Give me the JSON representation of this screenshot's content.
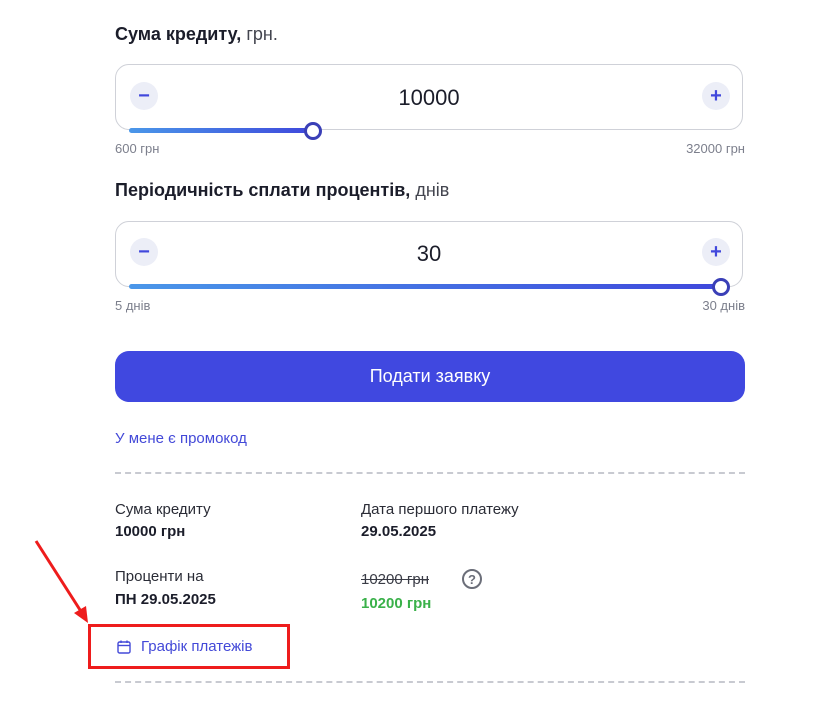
{
  "loan_amount": {
    "title": "Сума кредиту,",
    "unit": "грн.",
    "value": "10000",
    "min_label": "600 грн",
    "max_label": "32000 грн",
    "level_fraction": 0.31,
    "decrease_icon": "minus-icon",
    "increase_icon": "plus-icon"
  },
  "interest_period": {
    "title": "Періодичність сплати процентів,",
    "unit": "днів",
    "value": "30",
    "min_label": "5 днів",
    "max_label": "30 днів",
    "level_fraction": 1.0,
    "decrease_icon": "minus-icon",
    "increase_icon": "plus-icon"
  },
  "submit_label": "Подати заявку",
  "promo_link": "У мене є промокод",
  "summary": {
    "amount_label": "Сума кредиту",
    "amount_value": "10000 грн",
    "first_payment_label": "Дата першого платежу",
    "first_payment_value": "29.05.2025",
    "interest_label": "Проценти на",
    "interest_date": "ПН 29.05.2025",
    "old_total": "10200 грн",
    "new_total": "10200 грн",
    "help_icon": "question-icon"
  },
  "schedule_link": "Графік платежів",
  "schedule_icon": "calendar-icon",
  "annotation_color": "#ee1c1c",
  "accent_color": "#4048e0",
  "price_color": "#3ab14a"
}
